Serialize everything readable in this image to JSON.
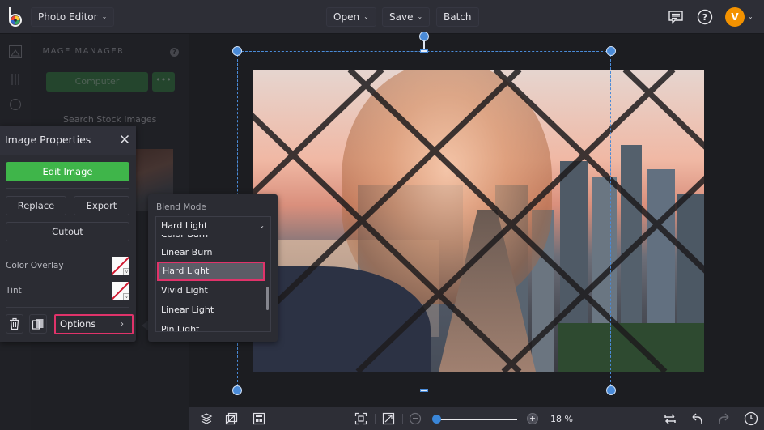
{
  "topbar": {
    "app_menu_label": "Photo Editor",
    "open_label": "Open",
    "save_label": "Save",
    "batch_label": "Batch",
    "avatar_initial": "V",
    "icons": [
      "logo-icon",
      "feedback-icon",
      "help-icon",
      "avatar"
    ]
  },
  "image_manager": {
    "title": "IMAGE MANAGER",
    "help": "?",
    "computer_label": "Computer",
    "more_label": "•••",
    "stock_label": "Search Stock Images"
  },
  "image_properties": {
    "title": "Image Properties",
    "edit_label": "Edit Image",
    "replace_label": "Replace",
    "export_label": "Export",
    "cutout_label": "Cutout",
    "color_overlay_label": "Color Overlay",
    "tint_label": "Tint",
    "options_label": "Options",
    "options_arrow": "›"
  },
  "blend_mode": {
    "label": "Blend Mode",
    "selected": "Hard Light",
    "options": [
      "Color Burn",
      "Linear Burn",
      "Hard Light",
      "Vivid Light",
      "Linear Light",
      "Pin Light"
    ],
    "highlighted_index": 2
  },
  "bottombar": {
    "zoom_value": "18 %",
    "zoom_fraction": 0.0,
    "icons": [
      "layers-icon",
      "crop-canvas-icon",
      "layout-icon",
      "fit-screen-icon",
      "actual-size-icon",
      "zoom-out-icon",
      "zoom-in-icon",
      "swap-icon",
      "undo-icon",
      "redo-icon",
      "history-icon"
    ]
  },
  "colors": {
    "accent_green": "#3fb54a",
    "highlight_pink": "#e0336a",
    "selection_blue": "#4a8bd8",
    "avatar_orange": "#f39200"
  }
}
